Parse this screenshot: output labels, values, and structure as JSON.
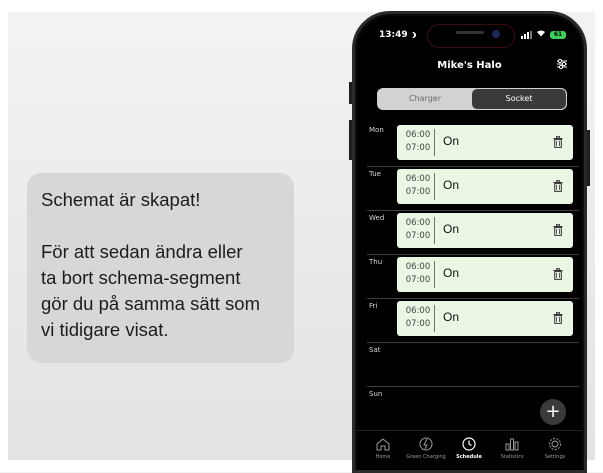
{
  "caption": {
    "line1": "Schemat är skapat!",
    "line2": "För att sedan ändra eller",
    "line3": "ta bort schema-segment",
    "line4": "gör du på samma sätt som",
    "line5": "vi tidigare visat."
  },
  "status": {
    "time": "13:49",
    "battery": "61"
  },
  "header": {
    "title": "Mike's Halo",
    "filter_icon": "sliders-icon"
  },
  "segment": {
    "charger": "Charger",
    "socket": "Socket",
    "selected": "Socket"
  },
  "days": [
    {
      "label": "Mon",
      "start": "06:00",
      "end": "07:00",
      "state": "On"
    },
    {
      "label": "Tue",
      "start": "06:00",
      "end": "07:00",
      "state": "On"
    },
    {
      "label": "Wed",
      "start": "06:00",
      "end": "07:00",
      "state": "On"
    },
    {
      "label": "Thu",
      "start": "06:00",
      "end": "07:00",
      "state": "On"
    },
    {
      "label": "Fri",
      "start": "06:00",
      "end": "07:00",
      "state": "On"
    },
    {
      "label": "Sat"
    },
    {
      "label": "Sun"
    }
  ],
  "fab": {
    "label": "+"
  },
  "tabs": [
    {
      "label": "Home",
      "icon": "home-icon"
    },
    {
      "label": "Green Charging",
      "icon": "green-charging-icon"
    },
    {
      "label": "Schedule",
      "icon": "clock-icon",
      "active": true
    },
    {
      "label": "Statistics",
      "icon": "statistics-icon"
    },
    {
      "label": "Settings",
      "icon": "settings-icon"
    }
  ],
  "colors": {
    "slot_bg": "#e9f7e4",
    "segment_selected": "#3a3a3a",
    "battery": "#3bd15a"
  }
}
